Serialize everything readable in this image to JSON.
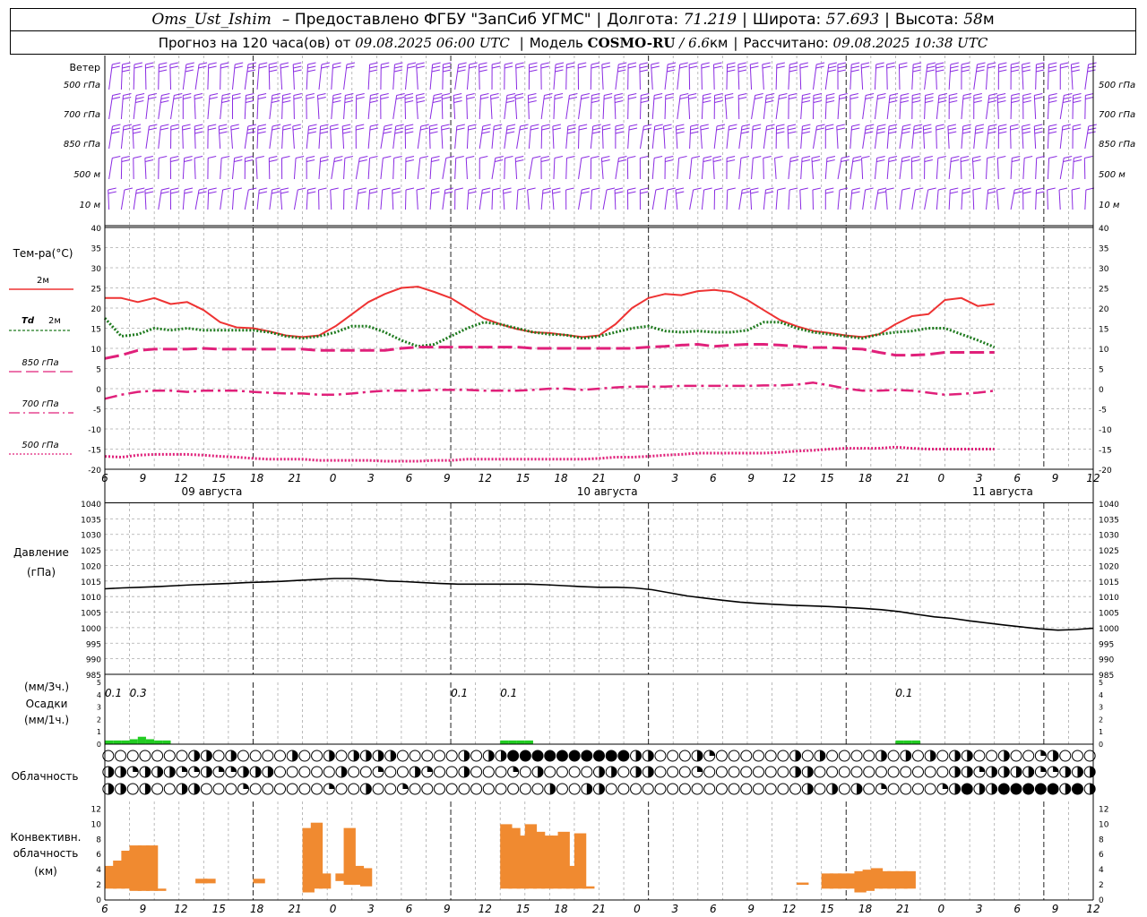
{
  "header": {
    "station": "Oms_Ust_Ishim",
    "provider": "– Предоставлено ФГБУ \"ЗапСиб УГМС\"",
    "lon_label": "Долгота:",
    "lon": "71.219",
    "lat_label": "Широта:",
    "lat": "57.693",
    "alt_label": "Высота:",
    "alt": "58",
    "alt_unit": "м",
    "forecast_label": "Прогноз на 120 часа(ов) от",
    "forecast_time": "09.08.2025 06:00 UTC",
    "model_label": "Модель",
    "model": "COSMO-RU",
    "resolution": "/ 6.6",
    "resolution_unit": "км",
    "calc_label": "Рассчитано:",
    "calc_time": "09.08.2025 10:38 UTC"
  },
  "chart_data": [
    {
      "type": "wind_barbs",
      "title": "Ветер",
      "levels": [
        "500 гПа",
        "700 гПа",
        "850 гПа",
        "500 м",
        "10 м"
      ],
      "right_levels": [
        "500 гПа",
        "700 гПа",
        "850 гПа",
        "500 м",
        "10 м"
      ],
      "color": "#8a2be2"
    },
    {
      "type": "line",
      "title": "Тем-ра(°C)",
      "ylim": [
        -20,
        40
      ],
      "yticks": [
        40,
        35,
        30,
        25,
        20,
        15,
        10,
        5,
        0,
        -5,
        -10,
        -15,
        -20
      ],
      "series": [
        {
          "name": "2м",
          "color": "#ee3333",
          "style": "solid",
          "values": [
            22.5,
            22.5,
            21.5,
            22.5,
            21,
            21.5,
            19.5,
            16.5,
            15.2,
            15,
            14.2,
            13.2,
            12.8,
            13.2,
            15.5,
            18.5,
            21.5,
            23.5,
            25,
            25.3,
            24,
            22.5,
            20,
            17.5,
            16,
            14.8,
            14,
            13.8,
            13.3,
            12.8,
            13.2,
            16,
            20,
            22.5,
            23.5,
            23.2,
            24.2,
            24.5,
            24,
            22,
            19.5,
            17,
            15.5,
            14.3,
            13.8,
            13.2,
            12.8,
            13.5,
            16,
            18,
            18.5,
            22,
            22.5,
            20.5,
            21
          ]
        },
        {
          "name": "Td 2м",
          "color": "#1e7a1e",
          "style": "dotted",
          "values": [
            17.5,
            13,
            13.5,
            15,
            14.5,
            15,
            14.5,
            14.5,
            14.5,
            14.5,
            14,
            13,
            12.5,
            13,
            14,
            15.5,
            15.5,
            14,
            12,
            10.5,
            11,
            13,
            15,
            16.5,
            16,
            15,
            14,
            13.5,
            13.3,
            12.5,
            13,
            14,
            15,
            15.5,
            14.3,
            14,
            14.3,
            14,
            14,
            14.5,
            16.5,
            16.5,
            15,
            14,
            13.5,
            13,
            12.5,
            13.5,
            14,
            14.3,
            15,
            15,
            13.5,
            12,
            10.3
          ]
        },
        {
          "name": "850 гПа",
          "color": "#e0207a",
          "style": "dash",
          "values": [
            7.5,
            8.3,
            9.5,
            9.8,
            9.8,
            9.8,
            10,
            9.8,
            9.8,
            9.8,
            9.8,
            9.8,
            9.8,
            9.5,
            9.5,
            9.5,
            9.5,
            9.5,
            10,
            10.3,
            10.3,
            10.3,
            10.3,
            10.3,
            10.3,
            10.3,
            10,
            10,
            10,
            10,
            10,
            10,
            10,
            10.3,
            10.5,
            10.8,
            11,
            10.5,
            10.8,
            11,
            11,
            10.8,
            10.5,
            10.2,
            10.2,
            10,
            9.8,
            9,
            8.3,
            8.3,
            8.5,
            9,
            9,
            9,
            9
          ]
        },
        {
          "name": "700 гПа",
          "color": "#e0207a",
          "style": "dashdot",
          "values": [
            -2.5,
            -1.5,
            -0.8,
            -0.5,
            -0.5,
            -0.8,
            -0.5,
            -0.5,
            -0.5,
            -0.8,
            -1,
            -1.2,
            -1.2,
            -1.5,
            -1.5,
            -1.2,
            -0.8,
            -0.5,
            -0.5,
            -0.5,
            -0.3,
            -0.3,
            -0.3,
            -0.5,
            -0.5,
            -0.5,
            -0.3,
            0,
            0,
            -0.3,
            0,
            0.3,
            0.5,
            0.5,
            0.5,
            0.7,
            0.7,
            0.7,
            0.7,
            0.7,
            0.8,
            0.8,
            1,
            1.5,
            0.8,
            0,
            -0.5,
            -0.5,
            -0.3,
            -0.5,
            -1,
            -1.5,
            -1.3,
            -1,
            -0.5
          ]
        },
        {
          "name": "500 гПа",
          "color": "#e0207a",
          "style": "dotted",
          "values": [
            -16.8,
            -17,
            -16.5,
            -16.3,
            -16.3,
            -16.3,
            -16.5,
            -16.8,
            -17,
            -17.3,
            -17.5,
            -17.5,
            -17.5,
            -17.8,
            -17.8,
            -17.8,
            -17.8,
            -18,
            -18,
            -18,
            -17.8,
            -17.8,
            -17.5,
            -17.5,
            -17.5,
            -17.5,
            -17.5,
            -17.5,
            -17.5,
            -17.5,
            -17.3,
            -17,
            -17,
            -16.8,
            -16.5,
            -16.3,
            -16,
            -16,
            -16,
            -16,
            -16,
            -15.8,
            -15.5,
            -15.3,
            -15,
            -14.8,
            -14.8,
            -14.8,
            -14.5,
            -14.8,
            -15,
            -15,
            -15,
            -15,
            -15
          ]
        }
      ]
    },
    {
      "type": "line",
      "title": "Давление",
      "ylabel": "(гПа)",
      "ylim": [
        985,
        1040
      ],
      "yticks": [
        1040,
        1035,
        1030,
        1025,
        1020,
        1015,
        1010,
        1005,
        1000,
        995,
        990,
        985
      ],
      "series": [
        {
          "name": "Давление",
          "color": "#000000",
          "style": "solid",
          "values": [
            1012.5,
            1012.8,
            1013,
            1013.2,
            1013.5,
            1013.8,
            1014,
            1014.2,
            1014.5,
            1014.7,
            1014.9,
            1015.2,
            1015.5,
            1015.8,
            1015.8,
            1015.5,
            1015,
            1014.8,
            1014.5,
            1014.2,
            1014,
            1014,
            1014,
            1014,
            1014,
            1013.8,
            1013.5,
            1013.2,
            1013,
            1013,
            1012.8,
            1012.2,
            1011.2,
            1010.2,
            1009.5,
            1008.8,
            1008.2,
            1007.8,
            1007.5,
            1007.2,
            1007,
            1006.8,
            1006.5,
            1006.2,
            1005.8,
            1005.2,
            1004.3,
            1003.5,
            1003,
            1002.2,
            1001.5,
            1000.8,
            1000.2,
            999.6,
            999.2,
            999.4,
            999.8
          ]
        }
      ]
    },
    {
      "type": "bar",
      "title": "Осадки",
      "ylabel_top": "(мм/3ч.)",
      "ylabel_bottom": "(мм/1ч.)",
      "ylim": [
        0,
        5
      ],
      "yticks": [
        5,
        4,
        3,
        2,
        1,
        0
      ],
      "labels": [
        {
          "text": "0.1",
          "hour": 9
        },
        {
          "text": "0.3",
          "hour": 12
        },
        {
          "text": "0.1",
          "hour": 51
        },
        {
          "text": "0.1",
          "hour": 57
        },
        {
          "text": "0.1",
          "hour": 105
        }
      ],
      "bars": [
        {
          "hour": 6,
          "value": 0.15
        },
        {
          "hour": 7,
          "value": 0.15
        },
        {
          "hour": 8,
          "value": 0.15
        },
        {
          "hour": 9,
          "value": 0.2
        },
        {
          "hour": 10,
          "value": 0.3
        },
        {
          "hour": 11,
          "value": 0.2
        },
        {
          "hour": 12,
          "value": 0.15
        },
        {
          "hour": 13,
          "value": 0.15
        },
        {
          "hour": 54,
          "value": 0.15
        },
        {
          "hour": 55,
          "value": 0.15
        },
        {
          "hour": 56,
          "value": 0.15
        },
        {
          "hour": 57,
          "value": 0.15
        },
        {
          "hour": 102,
          "value": 0.15
        },
        {
          "hour": 103,
          "value": 0.15
        },
        {
          "hour": 104,
          "value": 0.15
        }
      ],
      "color": "#22cc22"
    },
    {
      "type": "symbols",
      "title": "Облачность",
      "rows": 3,
      "legend_note": "octa circles"
    },
    {
      "type": "bar",
      "title": "Конвективн.",
      "title2": "облачность",
      "ylabel": "(км)",
      "ylim": [
        0,
        13
      ],
      "yticks": [
        12,
        10,
        8,
        6,
        4,
        2,
        0
      ],
      "color": "#f08a30",
      "bars": [
        {
          "hour": 6,
          "base": 1.5,
          "top": 4.5
        },
        {
          "hour": 7,
          "base": 1.5,
          "top": 5.2
        },
        {
          "hour": 8,
          "base": 1.5,
          "top": 6.5
        },
        {
          "hour": 9,
          "base": 1.2,
          "top": 7.2
        },
        {
          "hour": 10,
          "base": 1.2,
          "top": 7.2
        },
        {
          "hour": 11,
          "base": 1.2,
          "top": 7.2
        },
        {
          "hour": 12,
          "base": 1.2,
          "top": 1.5
        },
        {
          "hour": 17,
          "base": 2.2,
          "top": 2.8
        },
        {
          "hour": 18,
          "base": 2.2,
          "top": 2.8
        },
        {
          "hour": 24,
          "base": 2.2,
          "top": 2.8
        },
        {
          "hour": 30,
          "base": 1.0,
          "top": 9.5
        },
        {
          "hour": 31,
          "base": 1.5,
          "top": 10.2
        },
        {
          "hour": 32,
          "base": 1.5,
          "top": 3.5
        },
        {
          "hour": 34,
          "base": 2.5,
          "top": 3.5
        },
        {
          "hour": 35,
          "base": 2.0,
          "top": 9.5
        },
        {
          "hour": 36,
          "base": 2.0,
          "top": 4.5
        },
        {
          "hour": 37,
          "base": 1.8,
          "top": 4.2
        },
        {
          "hour": 54,
          "base": 1.5,
          "top": 10.0
        },
        {
          "hour": 55,
          "base": 1.5,
          "top": 9.5
        },
        {
          "hour": 56,
          "base": 1.5,
          "top": 8.5
        },
        {
          "hour": 57,
          "base": 1.5,
          "top": 10.0
        },
        {
          "hour": 58,
          "base": 1.5,
          "top": 9.0
        },
        {
          "hour": 59,
          "base": 1.5,
          "top": 8.5
        },
        {
          "hour": 60,
          "base": 1.5,
          "top": 8.5
        },
        {
          "hour": 61,
          "base": 1.5,
          "top": 9.0
        },
        {
          "hour": 62,
          "base": 1.5,
          "top": 4.5
        },
        {
          "hour": 63,
          "base": 1.5,
          "top": 8.8
        },
        {
          "hour": 64,
          "base": 1.5,
          "top": 1.8
        },
        {
          "hour": 90,
          "base": 2.0,
          "top": 2.3
        },
        {
          "hour": 93,
          "base": 1.5,
          "top": 3.5
        },
        {
          "hour": 94,
          "base": 1.5,
          "top": 3.5
        },
        {
          "hour": 95,
          "base": 1.5,
          "top": 3.5
        },
        {
          "hour": 96,
          "base": 1.5,
          "top": 3.5
        },
        {
          "hour": 97,
          "base": 1.0,
          "top": 3.8
        },
        {
          "hour": 98,
          "base": 1.2,
          "top": 4.0
        },
        {
          "hour": 99,
          "base": 1.5,
          "top": 4.2
        },
        {
          "hour": 100,
          "base": 1.5,
          "top": 3.8
        },
        {
          "hour": 101,
          "base": 1.5,
          "top": 3.8
        },
        {
          "hour": 102,
          "base": 1.5,
          "top": 3.8
        },
        {
          "hour": 103,
          "base": 1.5,
          "top": 3.8
        }
      ]
    }
  ],
  "xaxis": {
    "ticks": [
      "6",
      "9",
      "12",
      "15",
      "18",
      "21",
      "0",
      "3",
      "6",
      "9",
      "12",
      "15",
      "18",
      "21",
      "0",
      "3",
      "6",
      "9",
      "12",
      "15",
      "18",
      "21",
      "0",
      "3",
      "6",
      "9",
      "12"
    ],
    "days": [
      {
        "label": "09 августа",
        "hour": 9.5
      },
      {
        "label": "10 августа",
        "hour": 33.5
      },
      {
        "label": "11 августа",
        "hour": 57.5
      }
    ]
  },
  "labels": {
    "temp_2m": "2м",
    "td": "Td",
    "td_2m": "2м",
    "t850": "850 гПа",
    "t700": "700 гПа",
    "t500": "500 гПа"
  },
  "colors": {
    "wind": "#8a2be2",
    "temp": "#ee3333",
    "dew": "#1e7a1e",
    "upper": "#e0207a",
    "precip": "#22cc22",
    "conv": "#f08a30"
  }
}
